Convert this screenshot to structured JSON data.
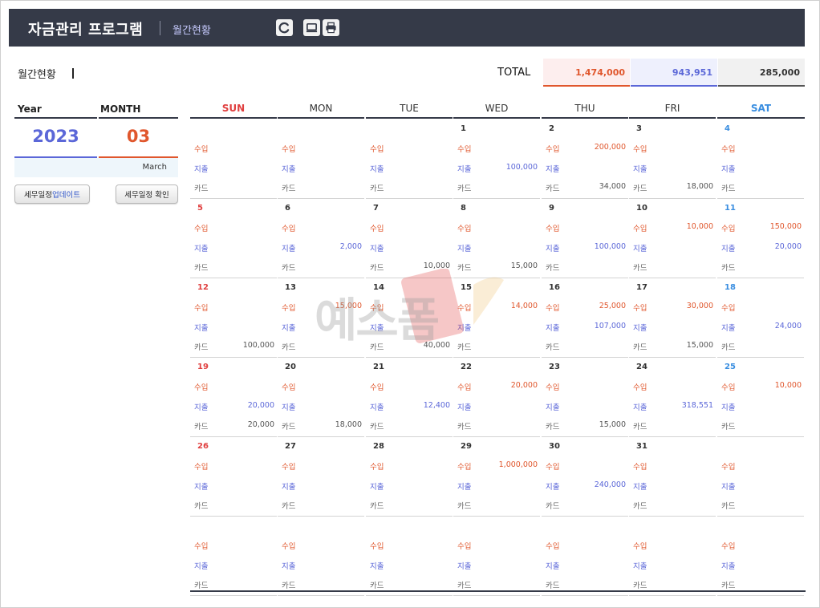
{
  "header": {
    "app_title": "자금관리 프로그램",
    "sub_title": "월간현황",
    "icons": [
      "refresh-icon",
      "monitor-icon",
      "print-icon"
    ]
  },
  "section": {
    "label": "월간현황"
  },
  "totals": {
    "label": "TOTAL",
    "income": "1,474,000",
    "expense": "943,951",
    "card": "285,000"
  },
  "period": {
    "year_label": "Year",
    "month_label": "MONTH",
    "year": "2023",
    "month": "03",
    "month_name": "March"
  },
  "buttons": {
    "update_prefix": "세무일정 ",
    "update_highlight": "업데이트",
    "check": "세무일정 확인"
  },
  "calendar": {
    "weekdays": [
      "SUN",
      "MON",
      "TUE",
      "WED",
      "THU",
      "FRI",
      "SAT"
    ],
    "labels": {
      "income": "수입",
      "expense": "지출",
      "card": "카드"
    },
    "weeks": [
      [
        {
          "day": "",
          "income": "",
          "expense": "",
          "card": ""
        },
        {
          "day": "",
          "income": "",
          "expense": "",
          "card": ""
        },
        {
          "day": "",
          "income": "",
          "expense": "",
          "card": ""
        },
        {
          "day": "1",
          "income": "",
          "expense": "100,000",
          "card": ""
        },
        {
          "day": "2",
          "income": "200,000",
          "expense": "",
          "card": "34,000"
        },
        {
          "day": "3",
          "income": "",
          "expense": "",
          "card": "18,000"
        },
        {
          "day": "4",
          "income": "",
          "expense": "",
          "card": ""
        }
      ],
      [
        {
          "day": "5",
          "income": "",
          "expense": "",
          "card": ""
        },
        {
          "day": "6",
          "income": "",
          "expense": "2,000",
          "card": ""
        },
        {
          "day": "7",
          "income": "",
          "expense": "",
          "card": "10,000"
        },
        {
          "day": "8",
          "income": "",
          "expense": "",
          "card": "15,000"
        },
        {
          "day": "9",
          "income": "",
          "expense": "100,000",
          "card": ""
        },
        {
          "day": "10",
          "income": "10,000",
          "expense": "",
          "card": ""
        },
        {
          "day": "11",
          "income": "150,000",
          "expense": "20,000",
          "card": ""
        }
      ],
      [
        {
          "day": "12",
          "income": "",
          "expense": "",
          "card": "100,000"
        },
        {
          "day": "13",
          "income": "15,000",
          "expense": "",
          "card": ""
        },
        {
          "day": "14",
          "income": "",
          "expense": "",
          "card": "40,000"
        },
        {
          "day": "15",
          "income": "14,000",
          "expense": "",
          "card": ""
        },
        {
          "day": "16",
          "income": "25,000",
          "expense": "107,000",
          "card": ""
        },
        {
          "day": "17",
          "income": "30,000",
          "expense": "",
          "card": "15,000"
        },
        {
          "day": "18",
          "income": "",
          "expense": "24,000",
          "card": ""
        }
      ],
      [
        {
          "day": "19",
          "income": "",
          "expense": "20,000",
          "card": "20,000"
        },
        {
          "day": "20",
          "income": "",
          "expense": "",
          "card": "18,000"
        },
        {
          "day": "21",
          "income": "",
          "expense": "12,400",
          "card": ""
        },
        {
          "day": "22",
          "income": "20,000",
          "expense": "",
          "card": ""
        },
        {
          "day": "23",
          "income": "",
          "expense": "",
          "card": "15,000"
        },
        {
          "day": "24",
          "income": "",
          "expense": "318,551",
          "card": ""
        },
        {
          "day": "25",
          "income": "10,000",
          "expense": "",
          "card": ""
        }
      ],
      [
        {
          "day": "26",
          "income": "",
          "expense": "",
          "card": ""
        },
        {
          "day": "27",
          "income": "",
          "expense": "",
          "card": ""
        },
        {
          "day": "28",
          "income": "",
          "expense": "",
          "card": ""
        },
        {
          "day": "29",
          "income": "1,000,000",
          "expense": "",
          "card": ""
        },
        {
          "day": "30",
          "income": "",
          "expense": "240,000",
          "card": ""
        },
        {
          "day": "31",
          "income": "",
          "expense": "",
          "card": ""
        },
        {
          "day": "",
          "income": "",
          "expense": "",
          "card": ""
        }
      ],
      [
        {
          "day": "",
          "income": "",
          "expense": "",
          "card": ""
        },
        {
          "day": "",
          "income": "",
          "expense": "",
          "card": ""
        },
        {
          "day": "",
          "income": "",
          "expense": "",
          "card": ""
        },
        {
          "day": "",
          "income": "",
          "expense": "",
          "card": ""
        },
        {
          "day": "",
          "income": "",
          "expense": "",
          "card": ""
        },
        {
          "day": "",
          "income": "",
          "expense": "",
          "card": ""
        },
        {
          "day": "",
          "income": "",
          "expense": "",
          "card": ""
        }
      ]
    ]
  },
  "watermark": {
    "text": "예스폼"
  },
  "colors": {
    "header_bg": "#353a48",
    "income": "#e0572d",
    "expense": "#5b67d8",
    "sunday": "#e04040",
    "saturday": "#3a8ee0"
  }
}
